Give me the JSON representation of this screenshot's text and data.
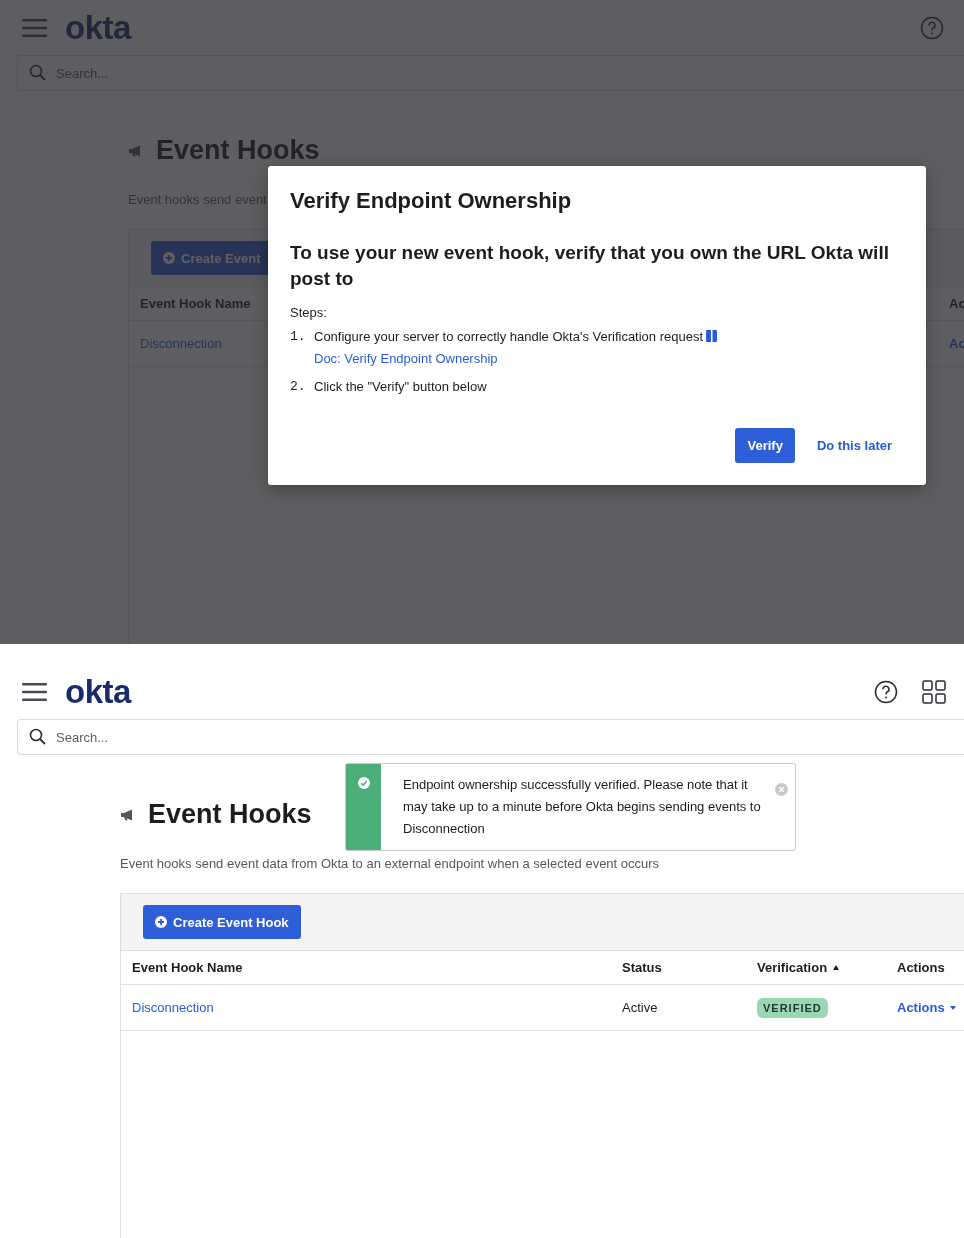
{
  "screens": [
    {
      "kind": "dialog",
      "logo": "okta",
      "search_placeholder": "Search...",
      "title": "Event Hooks",
      "description": "Event hooks send event",
      "create_button": "Create Event",
      "columns": [
        {
          "label": "Event Hook Name"
        },
        {
          "label": "Ac"
        }
      ],
      "rows": [
        {
          "name": "Disconnection",
          "actions": "Ac"
        }
      ],
      "dialog": {
        "title": "Verify Endpoint Ownership",
        "heading": "To use your new event hook, verify that you own the URL Okta will post to",
        "steps_label": "Steps:",
        "steps": [
          {
            "number": "1.",
            "text": "Configure your server to correctly handle Okta's Verification request",
            "link": "Doc: Verify Endpoint Ownership"
          },
          {
            "number": "2.",
            "text": "Click the \"Verify\" button below"
          }
        ],
        "buttons": [
          {
            "label": "Verify",
            "kind": "primary"
          },
          {
            "label": "Do this later",
            "kind": "link"
          }
        ]
      }
    },
    {
      "kind": "toast",
      "logo": "okta",
      "search_placeholder": "Search...",
      "title": "Event Hooks",
      "description": "Event hooks send event data from Okta to an external endpoint when a selected event occurs",
      "create_button": "Create Event Hook",
      "columns": [
        {
          "label": "Event Hook Name",
          "sorted": false
        },
        {
          "label": "Status",
          "sorted": false
        },
        {
          "label": "Verification",
          "sorted": true
        },
        {
          "label": "Actions",
          "sorted": false
        }
      ],
      "rows": [
        {
          "name": "Disconnection",
          "status": "Active",
          "verification": "VERIFIED",
          "actions": "Actions"
        }
      ],
      "toast": {
        "message": "Endpoint ownership successfully verified. Please note that it may take up to a minute before Okta begins sending events to Disconnection"
      }
    }
  ]
}
